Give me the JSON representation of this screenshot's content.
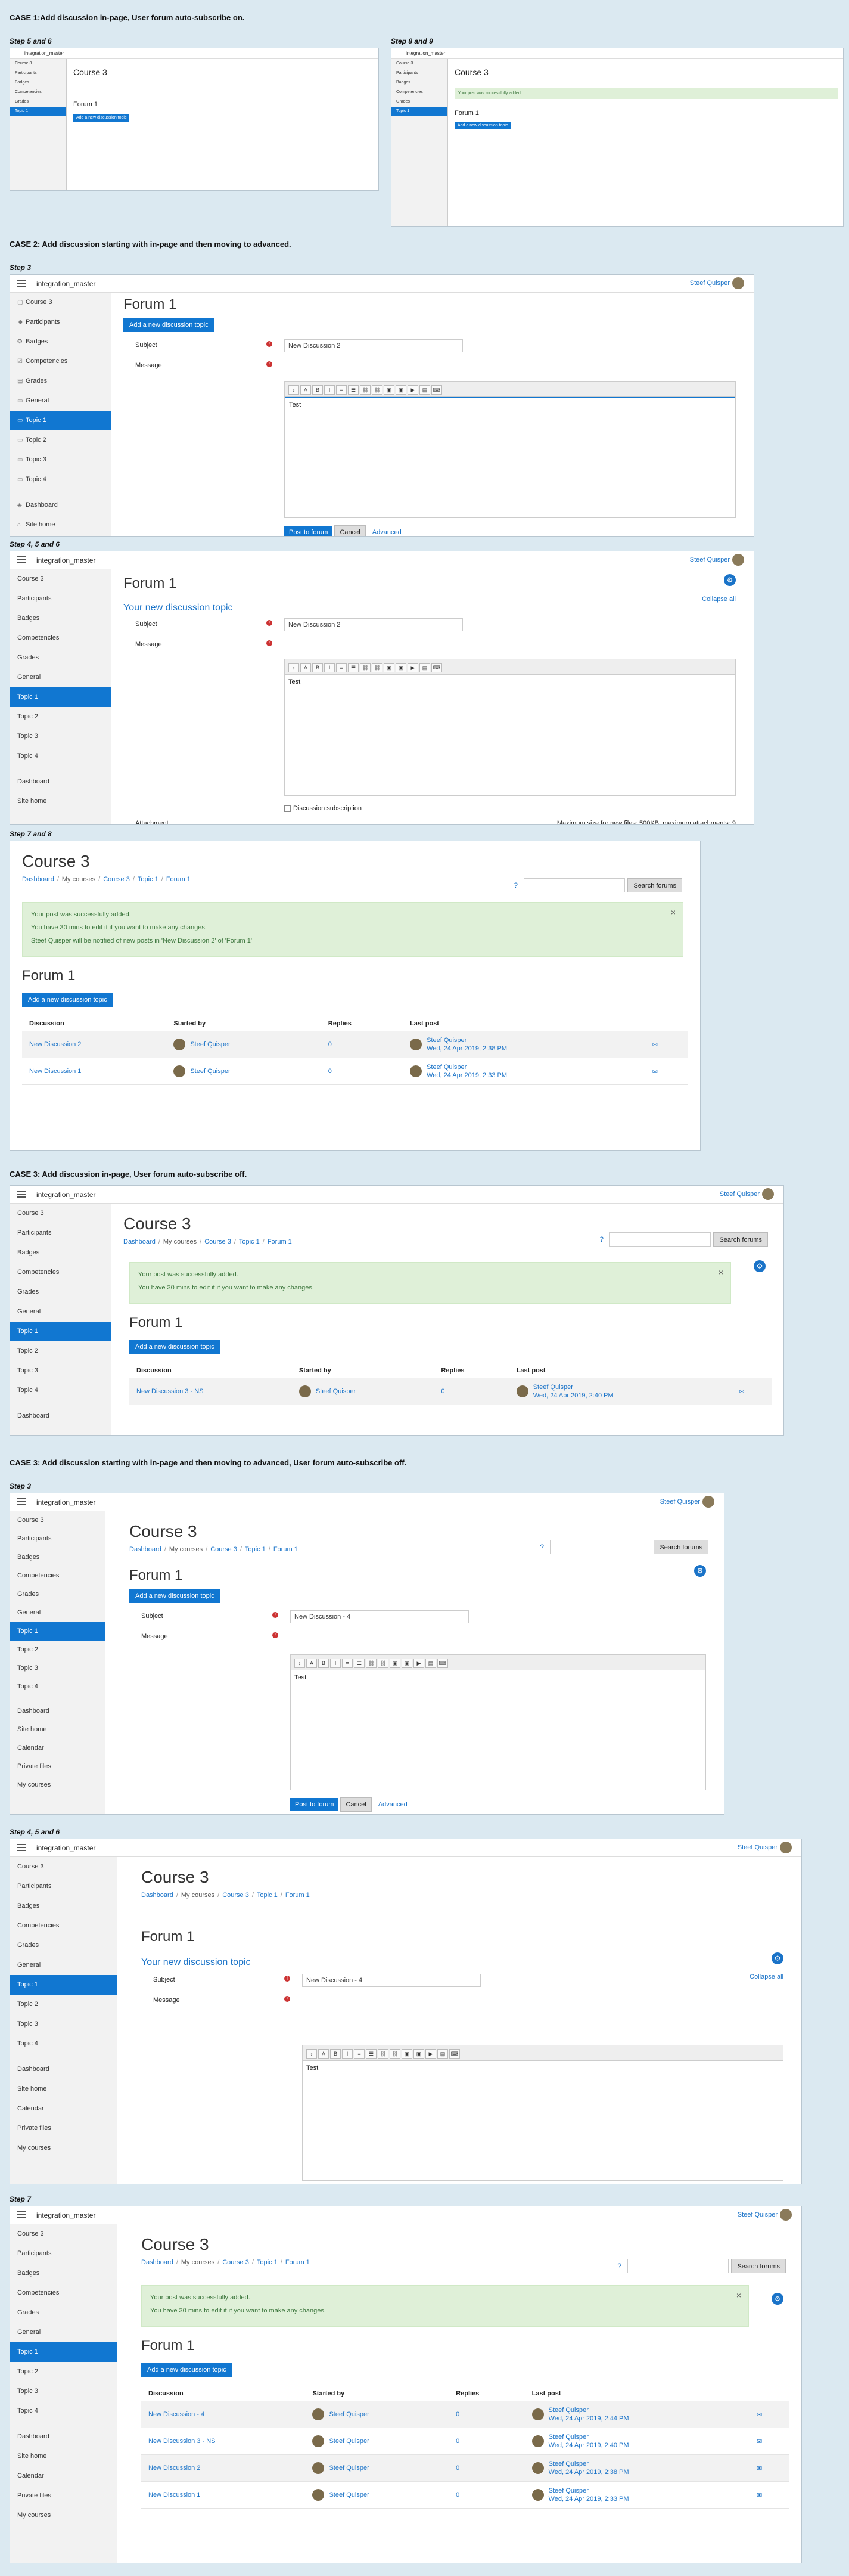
{
  "site": "integration_master",
  "user": "Steef Quisper",
  "case1": {
    "title": "CASE 1:Add discussion in-page, User forum auto-subscribe on.",
    "step_a": "Step 5 and 6",
    "step_b": "Step 8 and 9"
  },
  "case2": {
    "title": "CASE 2: Add discussion starting with in-page and then moving to advanced.",
    "step3": "Step 3",
    "step456": "Step 4, 5 and 6",
    "step78": "Step 7 and 8"
  },
  "case3a": {
    "title": "CASE 3: Add discussion in-page, User forum auto-subscribe off."
  },
  "case3b": {
    "title": "CASE 3: Add discussion starting with in-page and then moving to advanced, User forum auto-subscribe off.",
    "step3": "Step 3",
    "step456": "Step 4, 5 and 6",
    "step7": "Step 7"
  },
  "nav": {
    "course3": "Course 3",
    "participants": "Participants",
    "badges": "Badges",
    "competencies": "Competencies",
    "grades": "Grades",
    "general": "General",
    "topic1": "Topic 1",
    "topic2": "Topic 2",
    "topic3": "Topic 3",
    "topic4": "Topic 4",
    "dashboard": "Dashboard",
    "site_home": "Site home",
    "calendar": "Calendar",
    "private_files": "Private files",
    "my_courses": "My courses"
  },
  "course_title": "Course 3",
  "crumbs": {
    "dashboard": "Dashboard",
    "my_courses": "My courses",
    "course3": "Course 3",
    "topic1": "Topic 1",
    "forum1": "Forum 1"
  },
  "search_btn": "Search forums",
  "forum_title": "Forum 1",
  "add_btn": "Add a new discussion topic",
  "form": {
    "subject": "Subject",
    "message": "Message",
    "new_topic": "Your new discussion topic",
    "collapse_all": "Collapse all",
    "post_btn": "Post to forum",
    "cancel_btn": "Cancel",
    "advanced": "Advanced",
    "subscription": "Discussion subscription",
    "attachment": "Attachment",
    "max_size": "Maximum size for new files: 500KB, maximum attachments: 9",
    "subject2": "New Discussion 2",
    "message_text": "Test",
    "subject4": "New Discussion - 4"
  },
  "alerts": {
    "posted": "Your post was successfully added.",
    "edit": "You have 30 mins to edit it if you want to make any changes.",
    "notify": "Steef Quisper will be notified of new posts in 'New Discussion 2' of 'Forum 1'"
  },
  "table": {
    "h_discussion": "Discussion",
    "h_started": "Started by",
    "h_replies": "Replies",
    "h_last": "Last post"
  },
  "rows_case2": [
    {
      "title": "New Discussion 2",
      "by": "Steef Quisper",
      "replies": "0",
      "last_by": "Steef Quisper",
      "last_date": "Wed, 24 Apr 2019, 2:38 PM"
    },
    {
      "title": "New Discussion 1",
      "by": "Steef Quisper",
      "replies": "0",
      "last_by": "Steef Quisper",
      "last_date": "Wed, 24 Apr 2019, 2:33 PM"
    }
  ],
  "rows_case3a": [
    {
      "title": "New Discussion 3 - NS",
      "by": "Steef Quisper",
      "replies": "0",
      "last_by": "Steef Quisper",
      "last_date": "Wed, 24 Apr 2019, 2:40 PM"
    }
  ],
  "rows_case3b": [
    {
      "title": "New Discussion - 4",
      "by": "Steef Quisper",
      "replies": "0",
      "last_by": "Steef Quisper",
      "last_date": "Wed, 24 Apr 2019, 2:44 PM"
    },
    {
      "title": "New Discussion 3 - NS",
      "by": "Steef Quisper",
      "replies": "0",
      "last_by": "Steef Quisper",
      "last_date": "Wed, 24 Apr 2019, 2:40 PM"
    },
    {
      "title": "New Discussion 2",
      "by": "Steef Quisper",
      "replies": "0",
      "last_by": "Steef Quisper",
      "last_date": "Wed, 24 Apr 2019, 2:38 PM"
    },
    {
      "title": "New Discussion 1",
      "by": "Steef Quisper",
      "replies": "0",
      "last_by": "Steef Quisper",
      "last_date": "Wed, 24 Apr 2019, 2:33 PM"
    }
  ]
}
